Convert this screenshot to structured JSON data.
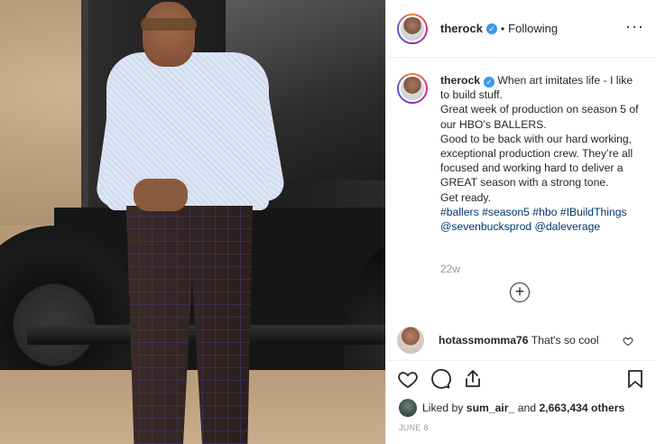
{
  "header": {
    "username": "therock",
    "verified_icon": "verified-badge-icon",
    "separator": "•",
    "follow_status": "Following",
    "more_icon": "more-options-icon"
  },
  "caption": {
    "username": "therock",
    "lines": [
      "When art imitates life - I like to build stuff.",
      "Great week of production on season 5 of our HBO’s BALLERS.",
      "Good to be back with our hard working, exceptional production crew. They’re all focused and working hard to deliver a GREAT season with a strong tone.",
      "Get ready."
    ],
    "hashtags": "#ballers #season5 #hbo #IBuildThings @sevenbucksprod @daleverage",
    "age": "22w"
  },
  "load_more": "+",
  "comment": {
    "username": "hotassmomma76",
    "text": "That's so cool"
  },
  "actions": {
    "like_icon": "heart-icon",
    "comment_icon": "comment-icon",
    "share_icon": "share-icon",
    "save_icon": "bookmark-icon"
  },
  "likes": {
    "prefix": "Liked by",
    "first_liker": "sum_air_",
    "joiner": "and",
    "others": "2,663,434 others"
  },
  "date": "JUNE 8",
  "colors": {
    "link": "#003569",
    "verified": "#3897f0",
    "muted": "#999999",
    "text": "#262626",
    "border": "#efefef"
  }
}
